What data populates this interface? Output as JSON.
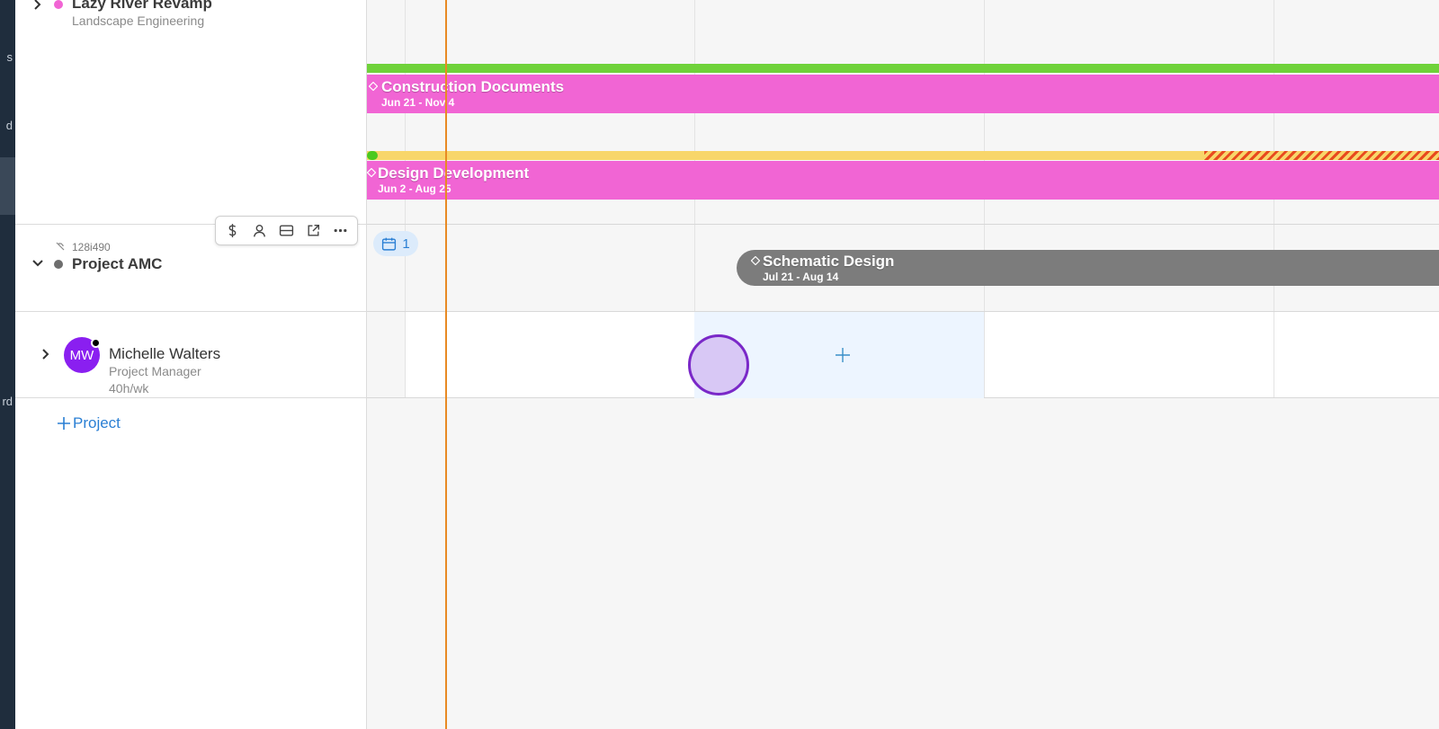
{
  "nav": {
    "fragments": [
      "s",
      "d",
      "rd"
    ]
  },
  "projects": [
    {
      "title": "Lazy River Revamp",
      "subtitle": "Landscape Engineering",
      "dot_color": "#f165d4"
    },
    {
      "title": "Project AMC",
      "code": "128i490",
      "dot_color": "#6e6e6e"
    }
  ],
  "toolbar": {
    "icons": [
      "dollar-icon",
      "person-icon",
      "card-icon",
      "external-link-icon",
      "more-icon"
    ]
  },
  "member": {
    "initials": "MW",
    "name": "Michelle Walters",
    "role": "Project Manager",
    "hours": "40h/wk"
  },
  "add_project": {
    "label": "Project"
  },
  "timeline": {
    "badge_count": "1",
    "phases": [
      {
        "title": "Construction Documents",
        "dates": "Jun 21 - Nov 4",
        "color": "#f165d4"
      },
      {
        "title": "Design Development",
        "dates": "Jun 2 - Aug 25",
        "color": "#f165d4"
      },
      {
        "title": "Schematic Design",
        "dates": "Jul 21 - Aug 14",
        "color": "#7c7c7c"
      }
    ],
    "today_line_color": "#e88a24"
  }
}
